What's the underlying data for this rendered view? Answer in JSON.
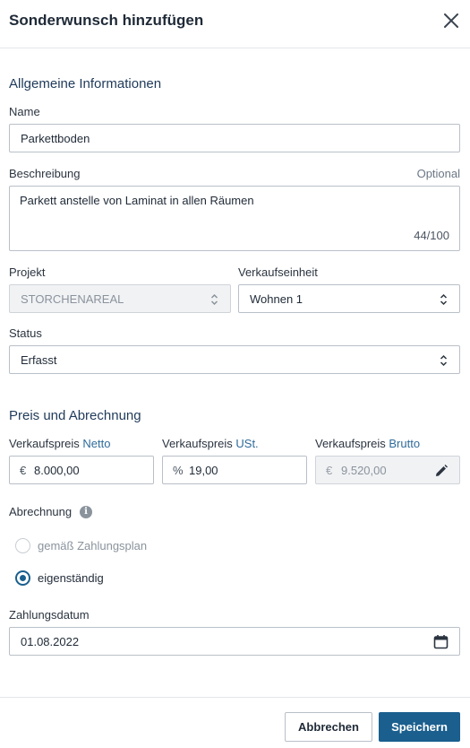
{
  "dialog": {
    "title": "Sonderwunsch hinzufügen",
    "close_icon": "close-icon"
  },
  "general": {
    "section_title": "Allgemeine Informationen",
    "name_label": "Name",
    "name_value": "Parkettboden",
    "description_label": "Beschreibung",
    "description_optional": "Optional",
    "description_value": "Parkett anstelle von Laminat in allen Räumen",
    "description_count": "44/100",
    "project_label": "Projekt",
    "project_value": "STORCHENAREAL",
    "unit_label": "Verkaufseinheit",
    "unit_value": "Wohnen 1",
    "status_label": "Status",
    "status_value": "Erfasst"
  },
  "pricing": {
    "section_title": "Preis und Abrechnung",
    "net_label_prefix": "Verkaufspreis",
    "net_label_accent": "Netto",
    "net_currency": "€",
    "net_value": "8.000,00",
    "vat_label_prefix": "Verkaufspreis",
    "vat_label_accent": "USt.",
    "vat_unit": "%",
    "vat_value": "19,00",
    "gross_label_prefix": "Verkaufspreis",
    "gross_label_accent": "Brutto",
    "gross_currency": "€",
    "gross_value": "9.520,00",
    "billing_label": "Abrechnung",
    "billing_info_glyph": "i",
    "billing_options": [
      {
        "label": "gemäß Zahlungsplan",
        "selected": false,
        "disabled": true
      },
      {
        "label": "eigenständig",
        "selected": true,
        "disabled": false
      }
    ],
    "payment_date_label": "Zahlungsdatum",
    "payment_date_value": "01.08.2022"
  },
  "footer": {
    "cancel_label": "Abbrechen",
    "save_label": "Speichern"
  },
  "colors": {
    "primary": "#1a5f8e",
    "accent_text": "#2f6b9a",
    "border": "#b9c0c8"
  }
}
